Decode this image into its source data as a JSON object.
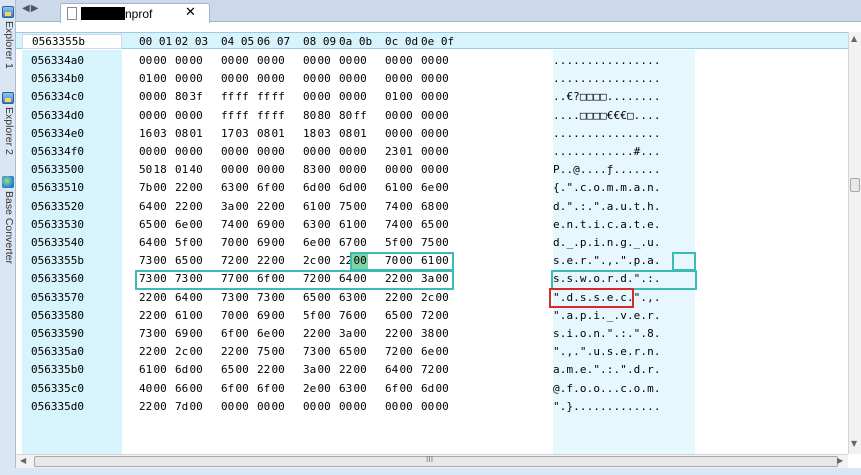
{
  "sidebar": {
    "tabs": [
      {
        "label": "Explorer 1",
        "icon": "explorer-icon"
      },
      {
        "label": "Explorer 2",
        "icon": "explorer-icon"
      },
      {
        "label": "Base Converter",
        "icon": "base-converter-icon"
      }
    ]
  },
  "tabbar": {
    "nav_arrows": "◀▶",
    "tab_name": "nprof",
    "close_glyph": "✕"
  },
  "header": {
    "offset": "0563355b",
    "columns": [
      "00 01",
      "02 03",
      "04 05",
      "06 07",
      "08 09",
      "0a 0b",
      "0c 0d",
      "0e 0f"
    ]
  },
  "rows": [
    {
      "offset": "056334a0",
      "bytes": [
        "00",
        "00",
        "00",
        "00",
        "00",
        "00",
        "00",
        "00",
        "00",
        "00",
        "00",
        "00",
        "00",
        "00",
        "00",
        "00"
      ],
      "ascii": "................"
    },
    {
      "offset": "056334b0",
      "bytes": [
        "01",
        "00",
        "00",
        "00",
        "00",
        "00",
        "00",
        "00",
        "00",
        "00",
        "00",
        "00",
        "00",
        "00",
        "00",
        "00"
      ],
      "ascii": "................"
    },
    {
      "offset": "056334c0",
      "bytes": [
        "00",
        "00",
        "80",
        "3f",
        "ff",
        "ff",
        "ff",
        "ff",
        "00",
        "00",
        "00",
        "00",
        "01",
        "00",
        "00",
        "00"
      ],
      "ascii": "..€?□□□□........"
    },
    {
      "offset": "056334d0",
      "bytes": [
        "00",
        "00",
        "00",
        "00",
        "ff",
        "ff",
        "ff",
        "ff",
        "80",
        "80",
        "80",
        "ff",
        "00",
        "00",
        "00",
        "00"
      ],
      "ascii": "....□□□□€€€□...."
    },
    {
      "offset": "056334e0",
      "bytes": [
        "16",
        "03",
        "08",
        "01",
        "17",
        "03",
        "08",
        "01",
        "18",
        "03",
        "08",
        "01",
        "00",
        "00",
        "00",
        "00"
      ],
      "ascii": "................"
    },
    {
      "offset": "056334f0",
      "bytes": [
        "00",
        "00",
        "00",
        "00",
        "00",
        "00",
        "00",
        "00",
        "00",
        "00",
        "00",
        "00",
        "23",
        "01",
        "00",
        "00"
      ],
      "ascii": "............#..."
    },
    {
      "offset": "05633500",
      "bytes": [
        "50",
        "18",
        "01",
        "40",
        "00",
        "00",
        "00",
        "00",
        "83",
        "00",
        "00",
        "00",
        "00",
        "00",
        "00",
        "00"
      ],
      "ascii": "P..@....ƒ......."
    },
    {
      "offset": "05633510",
      "bytes": [
        "7b",
        "00",
        "22",
        "00",
        "63",
        "00",
        "6f",
        "00",
        "6d",
        "00",
        "6d",
        "00",
        "61",
        "00",
        "6e",
        "00"
      ],
      "ascii": "{.\".c.o.m.m.a.n."
    },
    {
      "offset": "05633520",
      "bytes": [
        "64",
        "00",
        "22",
        "00",
        "3a",
        "00",
        "22",
        "00",
        "61",
        "00",
        "75",
        "00",
        "74",
        "00",
        "68",
        "00"
      ],
      "ascii": "d.\".:.\".a.u.t.h."
    },
    {
      "offset": "05633530",
      "bytes": [
        "65",
        "00",
        "6e",
        "00",
        "74",
        "00",
        "69",
        "00",
        "63",
        "00",
        "61",
        "00",
        "74",
        "00",
        "65",
        "00"
      ],
      "ascii": "e.n.t.i.c.a.t.e."
    },
    {
      "offset": "05633540",
      "bytes": [
        "64",
        "00",
        "5f",
        "00",
        "70",
        "00",
        "69",
        "00",
        "6e",
        "00",
        "67",
        "00",
        "5f",
        "00",
        "75",
        "00"
      ],
      "ascii": "d._.p.i.n.g._.u."
    },
    {
      "offset": "0563355b",
      "bytes": [
        "73",
        "00",
        "65",
        "00",
        "72",
        "00",
        "22",
        "00",
        "2c",
        "00",
        "22",
        "00",
        "70",
        "00",
        "61",
        "00"
      ],
      "ascii": "s.e.r.\".,.\".p.a."
    },
    {
      "offset": "05633560",
      "bytes": [
        "73",
        "00",
        "73",
        "00",
        "77",
        "00",
        "6f",
        "00",
        "72",
        "00",
        "64",
        "00",
        "22",
        "00",
        "3a",
        "00"
      ],
      "ascii": "s.s.w.o.r.d.\".:."
    },
    {
      "offset": "05633570",
      "bytes": [
        "22",
        "00",
        "64",
        "00",
        "73",
        "00",
        "73",
        "00",
        "65",
        "00",
        "63",
        "00",
        "22",
        "00",
        "2c",
        "00"
      ],
      "ascii": "\".d.s.s.e.c.\".,."
    },
    {
      "offset": "05633580",
      "bytes": [
        "22",
        "00",
        "61",
        "00",
        "70",
        "00",
        "69",
        "00",
        "5f",
        "00",
        "76",
        "00",
        "65",
        "00",
        "72",
        "00"
      ],
      "ascii": "\".a.p.i._.v.e.r."
    },
    {
      "offset": "05633590",
      "bytes": [
        "73",
        "00",
        "69",
        "00",
        "6f",
        "00",
        "6e",
        "00",
        "22",
        "00",
        "3a",
        "00",
        "22",
        "00",
        "38",
        "00"
      ],
      "ascii": "s.i.o.n.\".:.\".8."
    },
    {
      "offset": "056335a0",
      "bytes": [
        "22",
        "00",
        "2c",
        "00",
        "22",
        "00",
        "75",
        "00",
        "73",
        "00",
        "65",
        "00",
        "72",
        "00",
        "6e",
        "00"
      ],
      "ascii": "\".,.\".u.s.e.r.n."
    },
    {
      "offset": "056335b0",
      "bytes": [
        "61",
        "00",
        "6d",
        "00",
        "65",
        "00",
        "22",
        "00",
        "3a",
        "00",
        "22",
        "00",
        "64",
        "00",
        "72",
        "00"
      ],
      "ascii": "a.m.e.\".:.\".d.r."
    },
    {
      "offset": "056335c0",
      "bytes": [
        "40",
        "00",
        "66",
        "00",
        "6f",
        "00",
        "6f",
        "00",
        "2e",
        "00",
        "63",
        "00",
        "6f",
        "00",
        "6d",
        "00"
      ],
      "ascii": "@.f.o.o...c.o.m."
    },
    {
      "offset": "056335d0",
      "bytes": [
        "22",
        "00",
        "7d",
        "00",
        "00",
        "00",
        "00",
        "00",
        "00",
        "00",
        "00",
        "00",
        "00",
        "00",
        "00",
        "00"
      ],
      "ascii": "\".}............."
    }
  ],
  "colors": {
    "offset_column": "#d7f3fb",
    "highlight_green": "#7fd3a8",
    "box_teal": "#3bbbb4",
    "box_red": "#d42a2a"
  },
  "scroll": {
    "grip": "III"
  }
}
